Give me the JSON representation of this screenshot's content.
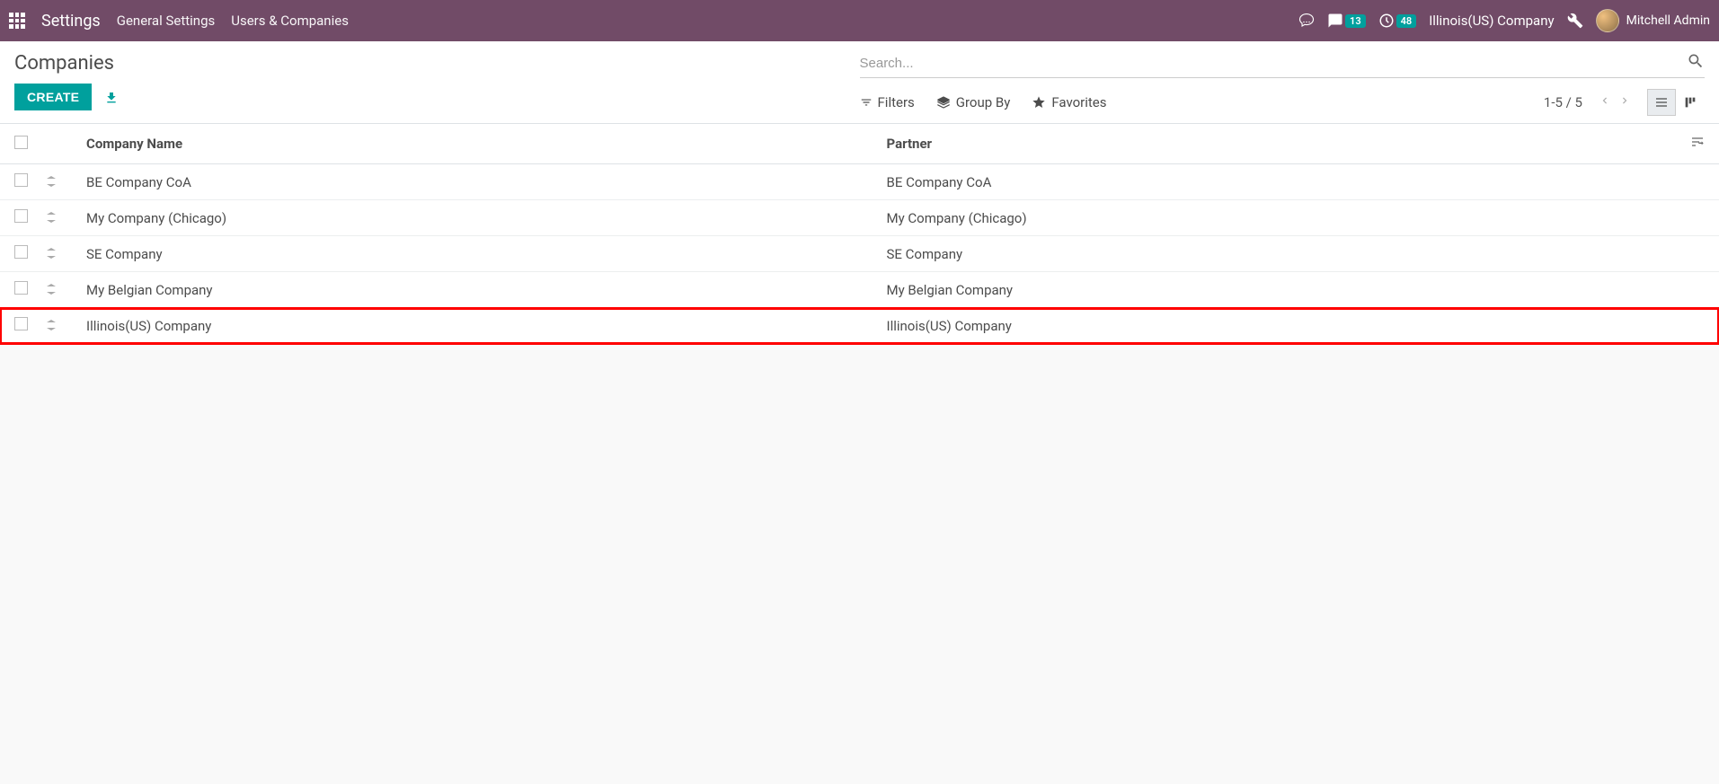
{
  "navbar": {
    "brand": "Settings",
    "menu": [
      {
        "label": "General Settings"
      },
      {
        "label": "Users & Companies"
      }
    ],
    "messages_count": "13",
    "activities_count": "48",
    "current_company": "Illinois(US) Company",
    "user_name": "Mitchell Admin"
  },
  "control": {
    "breadcrumb": "Companies",
    "create_label": "Create",
    "search_placeholder": "Search...",
    "filters_label": "Filters",
    "groupby_label": "Group By",
    "favorites_label": "Favorites",
    "pager": "1-5 / 5"
  },
  "table": {
    "columns": {
      "name": "Company Name",
      "partner": "Partner"
    },
    "rows": [
      {
        "name": "BE Company CoA",
        "partner": "BE Company CoA",
        "highlight": false
      },
      {
        "name": "My Company (Chicago)",
        "partner": "My Company (Chicago)",
        "highlight": false
      },
      {
        "name": "SE Company",
        "partner": "SE Company",
        "highlight": false
      },
      {
        "name": "My Belgian Company",
        "partner": "My Belgian Company",
        "highlight": false
      },
      {
        "name": "Illinois(US) Company",
        "partner": "Illinois(US) Company",
        "highlight": true
      }
    ]
  }
}
